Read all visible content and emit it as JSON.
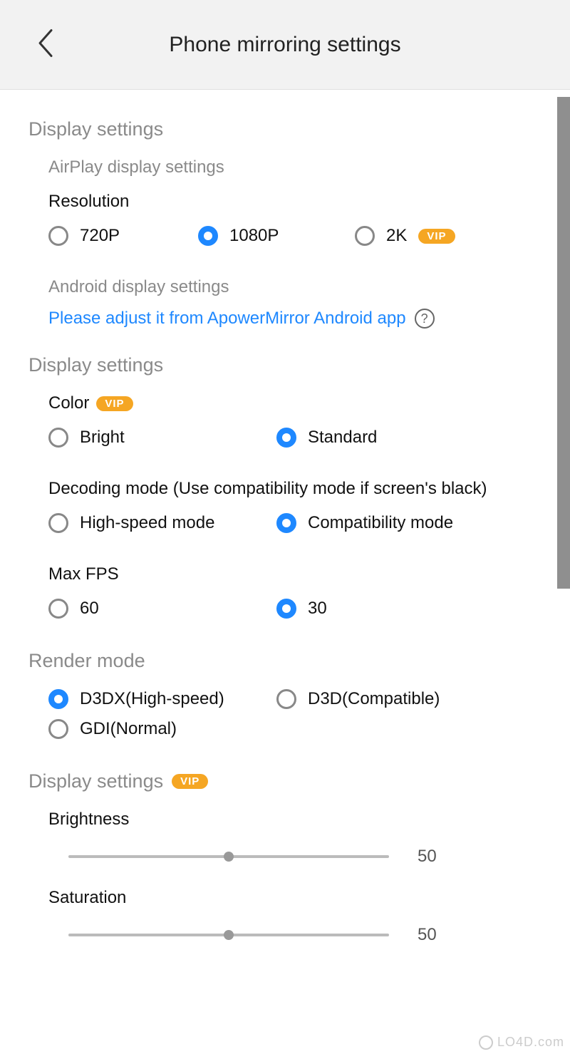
{
  "header": {
    "title": "Phone mirroring settings"
  },
  "sections": {
    "display1": {
      "title": "Display settings",
      "airplay_title": "AirPlay display settings",
      "resolution_label": "Resolution",
      "resolution_opts": {
        "r0": "720P",
        "r1": "1080P",
        "r2": "2K"
      },
      "android_title": "Android display settings",
      "android_link": "Please adjust it from ApowerMirror Android app"
    },
    "display2": {
      "title": "Display settings",
      "color_label": "Color",
      "color_opts": {
        "c0": "Bright",
        "c1": "Standard"
      },
      "decoding_label": "Decoding mode (Use compatibility mode if screen's black)",
      "decoding_opts": {
        "d0": "High-speed mode",
        "d1": "Compatibility mode"
      },
      "fps_label": "Max FPS",
      "fps_opts": {
        "f0": "60",
        "f1": "30"
      }
    },
    "render": {
      "title": "Render mode",
      "opts": {
        "r0": "D3DX(High-speed)",
        "r1": "D3D(Compatible)",
        "r2": "GDI(Normal)"
      }
    },
    "display3": {
      "title": "Display settings",
      "brightness_label": "Brightness",
      "brightness_value": "50",
      "saturation_label": "Saturation",
      "saturation_value": "50"
    }
  },
  "vip_text": "VIP",
  "watermark": "LO4D.com"
}
